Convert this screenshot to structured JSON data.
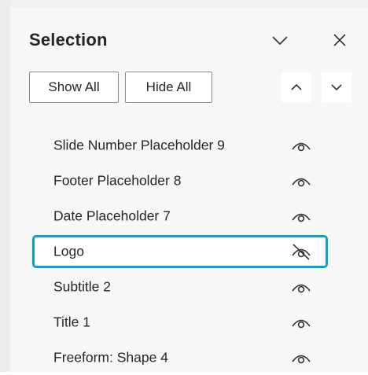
{
  "pane": {
    "title": "Selection",
    "collapse_icon": "chevron-down-icon",
    "close_icon": "close-icon"
  },
  "toolbar": {
    "show_all_label": "Show All",
    "hide_all_label": "Hide All",
    "bring_forward_icon": "chevron-up-icon",
    "send_backward_icon": "chevron-down-icon"
  },
  "items": [
    {
      "label": "Slide Number Placeholder 9",
      "visible": true,
      "selected": false
    },
    {
      "label": "Footer Placeholder 8",
      "visible": true,
      "selected": false
    },
    {
      "label": "Date Placeholder 7",
      "visible": true,
      "selected": false
    },
    {
      "label": "Logo",
      "visible": false,
      "selected": true
    },
    {
      "label": "Subtitle 2",
      "visible": true,
      "selected": false
    },
    {
      "label": "Title 1",
      "visible": true,
      "selected": false
    },
    {
      "label": "Freeform: Shape 4",
      "visible": true,
      "selected": false
    }
  ],
  "colors": {
    "selection_border": "#0aa3d1",
    "text": "#262626",
    "pane_background": "#f7f7f7"
  }
}
